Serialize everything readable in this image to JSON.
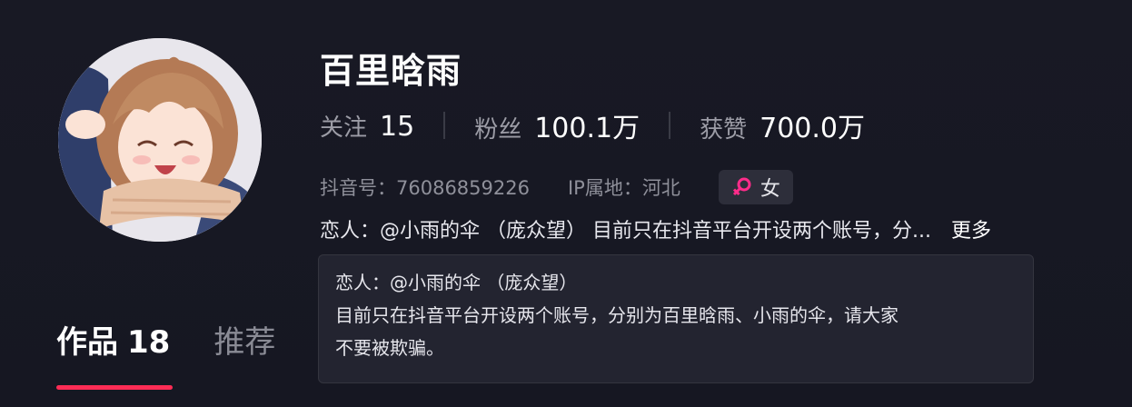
{
  "profile": {
    "name": "百里晗雨",
    "avatar_icon": "anime-girl-avatar"
  },
  "stats": {
    "following_label": "关注",
    "following_value": "15",
    "followers_label": "粉丝",
    "followers_value": "100.1万",
    "likes_label": "获赞",
    "likes_value": "700.0万"
  },
  "meta": {
    "douyin_id": "抖音号：76086859226",
    "ip_location": "IP属地：河北",
    "gender": "女",
    "gender_icon": "female-symbol-icon"
  },
  "bio": {
    "text": "恋人：@小雨的伞 （庞众望） 目前只在抖音平台开设两个账号，分...",
    "more_label": "更多"
  },
  "tooltip": {
    "line1": "恋人：@小雨的伞 （庞众望）",
    "line2": "目前只在抖音平台开设两个账号，分别为百里晗雨、小雨的伞，请大家",
    "line3": "不要被欺骗。"
  },
  "tabs": {
    "works_label": "作品",
    "works_count": "18",
    "recommend_label": "推荐"
  },
  "colors": {
    "background": "#161722",
    "accent": "#fe2c55",
    "female_icon": "#fe2c8a"
  }
}
